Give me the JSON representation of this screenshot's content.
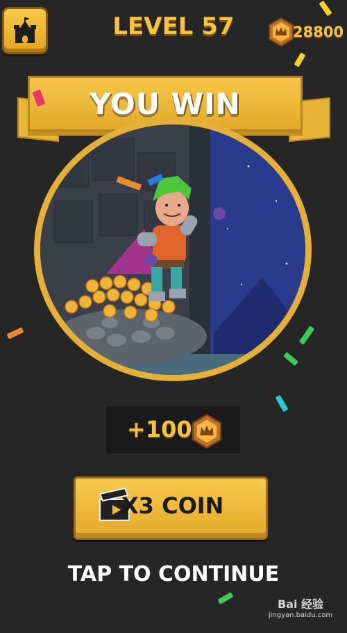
{
  "header": {
    "level_label": "LEVEL 57",
    "coins": "28800",
    "home_icon": "castle-icon"
  },
  "banner": {
    "title": "YOU WIN"
  },
  "reward": {
    "amount_label": "+100",
    "coin_icon": "crown-coin-icon"
  },
  "x3_button": {
    "label": "X3 COIN",
    "icon": "clapperboard-icon"
  },
  "continue_label": "TAP TO CONTINUE",
  "watermark": {
    "main": "Bai 经验",
    "sub": "jingyan.baidu.com"
  },
  "colors": {
    "background": "#262626",
    "gold": "#f6c244",
    "button_gold": "#efbb3f",
    "night_sky": "#2a3b8e"
  }
}
